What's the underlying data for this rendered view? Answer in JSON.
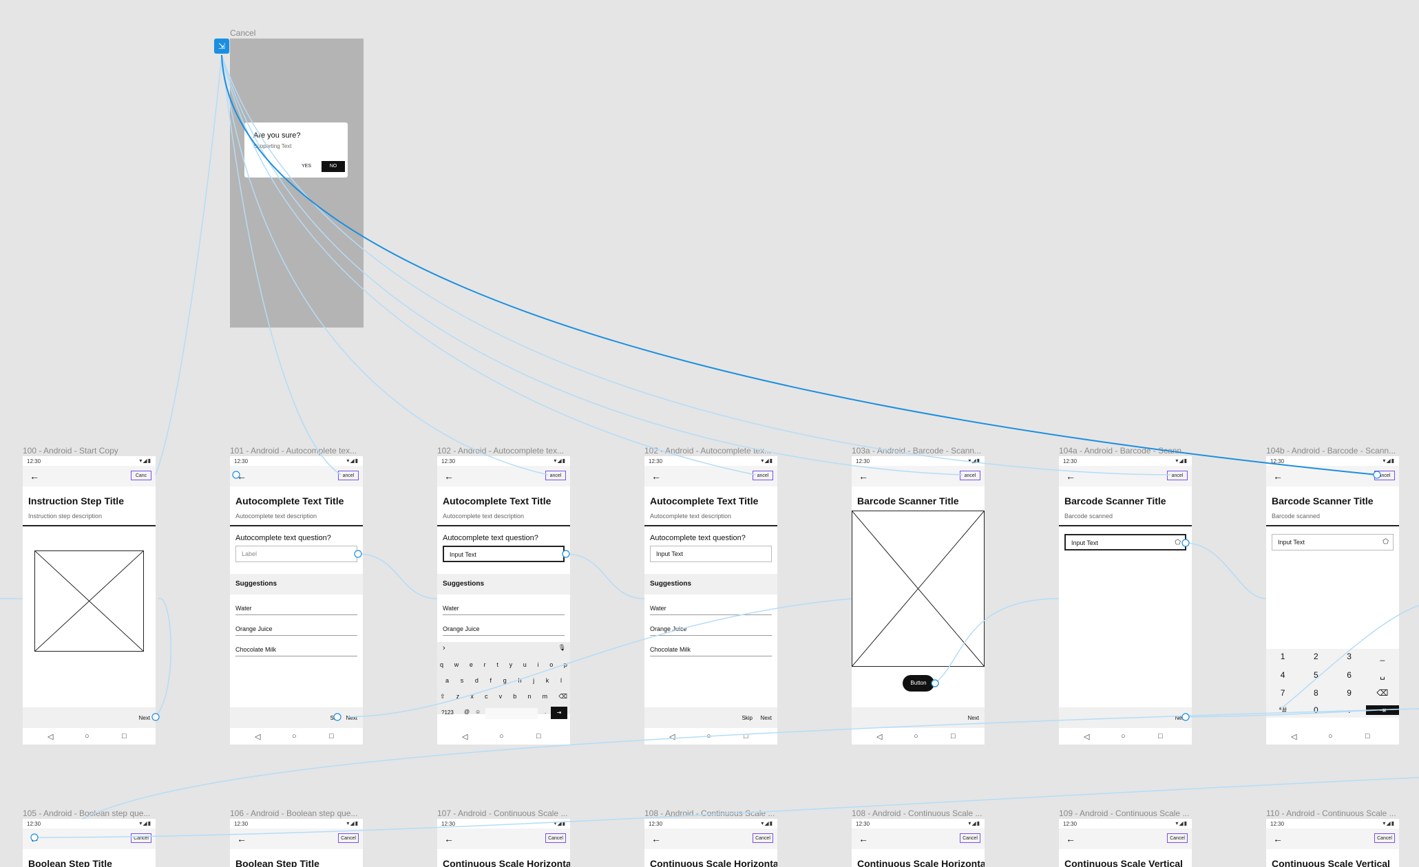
{
  "colors": {
    "canvas": "#e5e5e5",
    "flow_line": "#1a8fe0",
    "flow_line_light": "#b5dcf7",
    "cancel_outline": "#7b4ef0",
    "scrim": "#b4b4b4"
  },
  "overlay": {
    "label": "Cancel",
    "dialog_title": "Are you sure?",
    "dialog_text": "Supporting Text",
    "yes": "YES",
    "no": "NO",
    "link_icon": "flow-start-icon"
  },
  "status": {
    "time": "12:30",
    "icons": "▾◢▮"
  },
  "common": {
    "back": "←",
    "cancel": "Cancel",
    "nav_back": "◁",
    "nav_home": "○",
    "nav_recent": "□",
    "next": "Next",
    "skip": "Skip",
    "button": "Button"
  },
  "frames": {
    "f100": {
      "label": "100 - Android - Start Copy",
      "title": "Instruction Step Title",
      "desc": "Instruction step description",
      "cancel": "Canc"
    },
    "f101": {
      "label": "101 - Android -  Autocomplete tex...",
      "title": "Autocomplete Text Title",
      "desc": "Autocomplete text description",
      "question": "Autocomplete text question?",
      "input": "Label",
      "suggestions": "Suggestions",
      "items": [
        "Water",
        "Orange Juice",
        "Chocolate Milk"
      ],
      "cancel": "ancel"
    },
    "f102": {
      "label": "102 - Android -  Autocomplete tex...",
      "title": "Autocomplete Text Title",
      "desc": "Autocomplete text description",
      "question": "Autocomplete text question?",
      "input": "Input Text",
      "suggestions": "Suggestions",
      "items": [
        "Water",
        "Orange Juice"
      ],
      "cancel": "ancel"
    },
    "f102b": {
      "label": "102 - Android -  Autocomplete tex...",
      "title": "Autocomplete Text Title",
      "desc": "Autocomplete text description",
      "question": "Autocomplete text question?",
      "input": "Input Text",
      "suggestions": "Suggestions",
      "items": [
        "Water",
        "Orange Juice",
        "Chocolate Milk"
      ],
      "cancel": "ancel"
    },
    "f103a": {
      "label": "103a - Android -  Barcode - Scann...",
      "title": "Barcode Scanner Title",
      "cancel": "ancel"
    },
    "f104a": {
      "label": "104a - Android -  Barcode - Scann...",
      "title": "Barcode Scanner Title",
      "desc": "Barcode scanned",
      "input": "Input Text",
      "cancel": "ancel"
    },
    "f104b": {
      "label": "104b - Android -  Barcode - Scann...",
      "title": "Barcode Scanner Title",
      "desc": "Barcode scanned",
      "input": "Input Text",
      "cancel": "ancel"
    }
  },
  "keyboard": {
    "row1": [
      "q",
      "w",
      "e",
      "r",
      "t",
      "y",
      "u",
      "i",
      "o",
      "p"
    ],
    "row2": [
      "a",
      "s",
      "d",
      "f",
      "g",
      "h",
      "j",
      "k",
      "l"
    ],
    "row3": [
      "⇧",
      "z",
      "x",
      "c",
      "v",
      "b",
      "n",
      "m",
      "⌫"
    ],
    "row4": [
      "?123",
      "@",
      "☺",
      ".",
      "⇥"
    ],
    "chevron": "›",
    "mic": "🎙"
  },
  "numpad": {
    "rows": [
      [
        "1",
        "2",
        "3",
        "_"
      ],
      [
        "4",
        "5",
        "6",
        "␣"
      ],
      [
        "7",
        "8",
        "9",
        "⌫"
      ],
      [
        "*#",
        "0",
        ".",
        "⇥"
      ]
    ]
  },
  "bottom_frames": [
    {
      "label": "105 - Android -  Boolean step que...",
      "title": "Boolean Step Title",
      "cancel": "Cancel"
    },
    {
      "label": "106 - Android -  Boolean step que...",
      "title": "Boolean Step Title",
      "cancel": "Cancel"
    },
    {
      "label": "107 - Android -  Continuous Scale ...",
      "title": "Continuous Scale Horizontal",
      "cancel": "Cancel"
    },
    {
      "label": "108 - Android -  Continuous Scale ...",
      "title": "Continuous Scale Horizontal",
      "cancel": "Cancel"
    },
    {
      "label": "108 - Android -  Continuous Scale ...",
      "title": "Continuous Scale Horizontal",
      "cancel": "Cancel"
    },
    {
      "label": "109 - Android -  Continuous Scale ...",
      "title": "Continuous Scale Vertical",
      "cancel": "Cancel"
    },
    {
      "label": "110 - Android -  Continuous Scale ...",
      "title": "Continuous Scale Vertical",
      "cancel": "Cancel"
    }
  ]
}
